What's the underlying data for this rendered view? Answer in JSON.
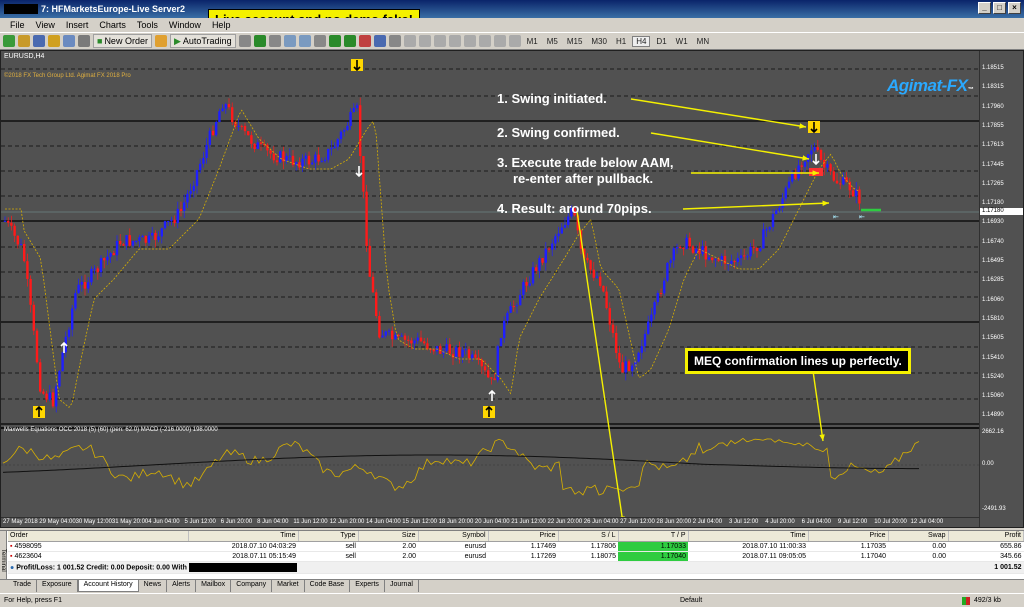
{
  "window": {
    "title": "7: HFMarketsEurope-Live Server2"
  },
  "menu": [
    "File",
    "View",
    "Insert",
    "Charts",
    "Tools",
    "Window",
    "Help"
  ],
  "toolbar": {
    "new_order": "New Order",
    "autotrading": "AutoTrading",
    "timeframes": [
      "M1",
      "M5",
      "M15",
      "M30",
      "H1",
      "H4",
      "D1",
      "W1",
      "MN"
    ],
    "active_tf": "H4"
  },
  "chart": {
    "symbol_tf": "EURUSD,H4",
    "copyright": "©2018 FX Tech Group Ltd. Agimat FX 2018 Pro",
    "logo_main": "Agimat-FX",
    "logo_tm": "™",
    "watermark": "EU",
    "indicator_label": "Maxwells Equations OCC 2018 (5) (60) (pen: 62.0) MACD (-216.0000) 198.0000",
    "prices": [
      "1.18515",
      "1.18315",
      "1.17960",
      "1.17855",
      "1.17613",
      "1.17445",
      "1.17265",
      "1.17180",
      "1.16930",
      "1.16740",
      "1.16495",
      "1.16285",
      "1.16060",
      "1.15810",
      "1.15605",
      "1.15410",
      "1.15240",
      "1.15060",
      "1.14890"
    ],
    "current_price": "1.17180",
    "ind_prices": [
      "2662.16",
      "0.00",
      "-2491.93"
    ],
    "dates": [
      "27 May 2018",
      "29 May 04:00",
      "30 May 12:00",
      "31 May 20:00",
      "4 Jun 04:00",
      "5 Jun 12:00",
      "6 Jun 20:00",
      "8 Jun 04:00",
      "11 Jun 12:00",
      "12 Jun 20:00",
      "14 Jun 04:00",
      "15 Jun 12:00",
      "18 Jun 20:00",
      "20 Jun 04:00",
      "21 Jun 12:00",
      "22 Jun 20:00",
      "26 Jun 04:00",
      "27 Jun 12:00",
      "28 Jun 20:00",
      "2 Jul 04:00",
      "3 Jul 12:00",
      "4 Jul 20:00",
      "6 Jul 04:00",
      "9 Jul 12:00",
      "10 Jul 20:00",
      "12 Jul 04:00"
    ]
  },
  "annotations": {
    "top_callout": "Live account and no demo fake!",
    "step1": "1. Swing initiated.",
    "step2": "2. Swing confirmed.",
    "step3a": "3. Execute trade below AAM,",
    "step3b": "re-enter after pullback.",
    "step4": "4. Result: around 70pips.",
    "meq": "MEQ confirmation lines up perfectly."
  },
  "orders": {
    "headers": [
      "Order",
      "Time",
      "Type",
      "Size",
      "Symbol",
      "Price",
      "S / L",
      "T / P",
      "Time",
      "Price",
      "Swap",
      "Profit"
    ],
    "rows": [
      [
        "4598095",
        "2018.07.10 04:03:29",
        "sell",
        "2.00",
        "eurusd",
        "1.17469",
        "1.17806",
        "1.17033",
        "2018.07.10 11:00:33",
        "1.17035",
        "0.00",
        "655.86"
      ],
      [
        "4623604",
        "2018.07.11 05:15:49",
        "sell",
        "2.00",
        "eurusd",
        "1.17269",
        "1.18075",
        "1.17040",
        "2018.07.11 09:05:05",
        "1.17040",
        "0.00",
        "345.66"
      ]
    ],
    "total_label": "Profit/Loss: 1 001.52  Credit: 0.00  Deposit: 0.00  With",
    "total_value": "1 001.52"
  },
  "tabs": [
    "Trade",
    "Exposure",
    "Account History",
    "News",
    "Alerts",
    "Mailbox",
    "Company",
    "Market",
    "Code Base",
    "Experts",
    "Journal"
  ],
  "active_tab": "Account History",
  "status": {
    "help": "For Help, press F1",
    "profile": "Default",
    "traffic": "492/3 kb"
  },
  "colors": {
    "bull": "#1f1fff",
    "bear": "#ff1a1a",
    "ma": "#d8b000",
    "background": "#515151",
    "callout": "#f5f100"
  }
}
